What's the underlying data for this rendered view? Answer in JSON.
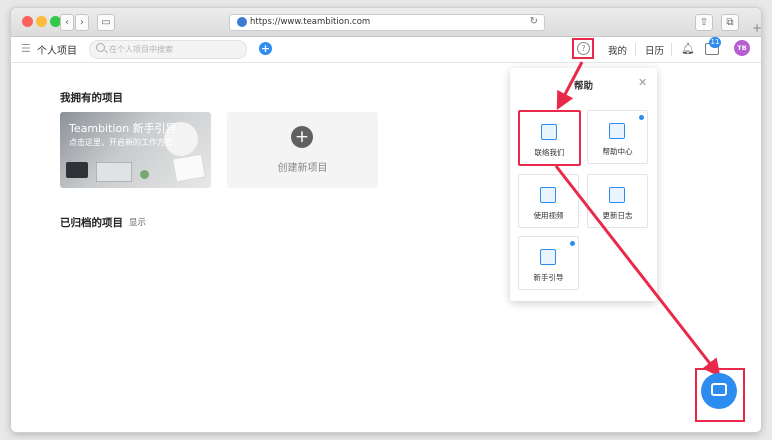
{
  "browser": {
    "url": "https://www.teambition.com"
  },
  "topbar": {
    "title": "个人项目",
    "search_placeholder": "在个人项目中搜索",
    "links": [
      "我的",
      "日历"
    ],
    "badge_count": "11",
    "avatar_initials": "TB"
  },
  "main": {
    "owned_heading": "我拥有的项目",
    "guide_card": {
      "title": "Teambition 新手引导",
      "subtitle": "点击这里，开启新的工作方式"
    },
    "create_label": "创建新项目",
    "archived_heading": "已归档的项目",
    "archived_show": "显示"
  },
  "help_panel": {
    "title": "帮助",
    "items": [
      {
        "label": "联络我们",
        "icon": "chat-board-icon",
        "highlighted": true,
        "new_dot": false
      },
      {
        "label": "帮助中心",
        "icon": "signpost-icon",
        "highlighted": false,
        "new_dot": true
      },
      {
        "label": "使用视频",
        "icon": "video-icon",
        "highlighted": false,
        "new_dot": false
      },
      {
        "label": "更新日志",
        "icon": "log-icon",
        "highlighted": false,
        "new_dot": false
      },
      {
        "label": "新手引导",
        "icon": "guide-icon",
        "highlighted": false,
        "new_dot": true
      }
    ]
  },
  "colors": {
    "accent": "#2d8cf0",
    "highlight": "#e8294a",
    "avatar": "#b660d0"
  }
}
